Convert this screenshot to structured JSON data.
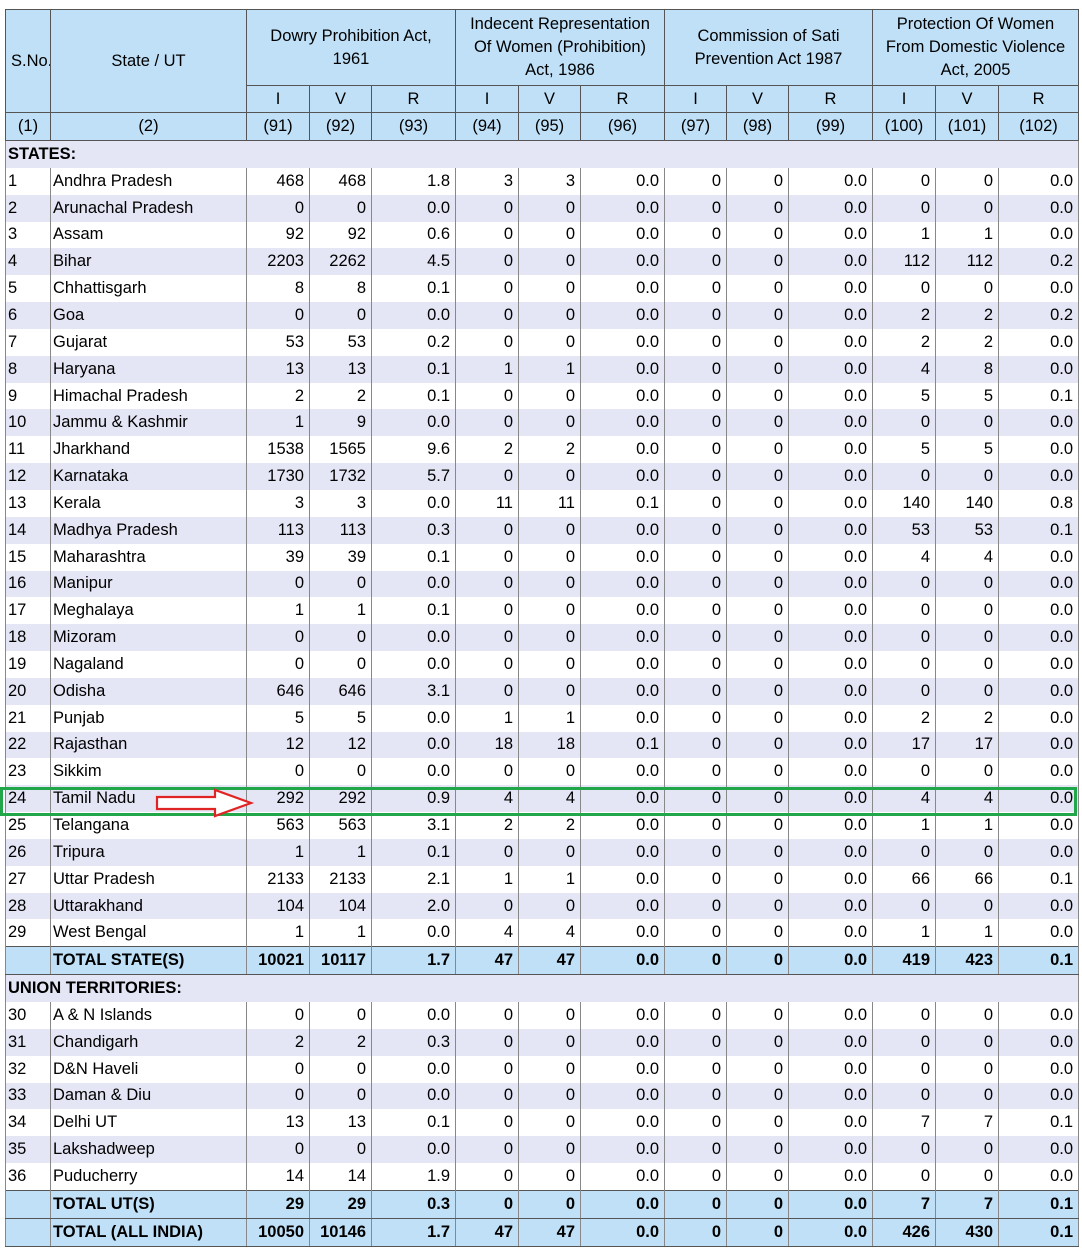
{
  "header": {
    "sno": "S.No.",
    "state": "State / UT",
    "groups": [
      "Dowry Prohibition Act, 1961",
      "Indecent Representation Of Women (Prohibition) Act, 1986",
      "Commission of Sati Prevention Act 1987",
      "Protection Of Women From Domestic Violence Act, 2005"
    ],
    "sub": [
      "I",
      "V",
      "R",
      "I",
      "V",
      "R",
      "I",
      "V",
      "R",
      "I",
      "V",
      "R"
    ],
    "colnums": [
      "(1)",
      "(2)",
      "(91)",
      "(92)",
      "(93)",
      "(94)",
      "(95)",
      "(96)",
      "(97)",
      "(98)",
      "(99)",
      "(100)",
      "(101)",
      "(102)"
    ]
  },
  "sections": [
    {
      "title": "STATES:",
      "rows": [
        [
          "1",
          "Andhra Pradesh",
          "468",
          "468",
          "1.8",
          "3",
          "3",
          "0.0",
          "0",
          "0",
          "0.0",
          "0",
          "0",
          "0.0"
        ],
        [
          "2",
          "Arunachal Pradesh",
          "0",
          "0",
          "0.0",
          "0",
          "0",
          "0.0",
          "0",
          "0",
          "0.0",
          "0",
          "0",
          "0.0"
        ],
        [
          "3",
          "Assam",
          "92",
          "92",
          "0.6",
          "0",
          "0",
          "0.0",
          "0",
          "0",
          "0.0",
          "1",
          "1",
          "0.0"
        ],
        [
          "4",
          "Bihar",
          "2203",
          "2262",
          "4.5",
          "0",
          "0",
          "0.0",
          "0",
          "0",
          "0.0",
          "112",
          "112",
          "0.2"
        ],
        [
          "5",
          "Chhattisgarh",
          "8",
          "8",
          "0.1",
          "0",
          "0",
          "0.0",
          "0",
          "0",
          "0.0",
          "0",
          "0",
          "0.0"
        ],
        [
          "6",
          "Goa",
          "0",
          "0",
          "0.0",
          "0",
          "0",
          "0.0",
          "0",
          "0",
          "0.0",
          "2",
          "2",
          "0.2"
        ],
        [
          "7",
          "Gujarat",
          "53",
          "53",
          "0.2",
          "0",
          "0",
          "0.0",
          "0",
          "0",
          "0.0",
          "2",
          "2",
          "0.0"
        ],
        [
          "8",
          "Haryana",
          "13",
          "13",
          "0.1",
          "1",
          "1",
          "0.0",
          "0",
          "0",
          "0.0",
          "4",
          "8",
          "0.0"
        ],
        [
          "9",
          "Himachal Pradesh",
          "2",
          "2",
          "0.1",
          "0",
          "0",
          "0.0",
          "0",
          "0",
          "0.0",
          "5",
          "5",
          "0.1"
        ],
        [
          "10",
          "Jammu & Kashmir",
          "1",
          "9",
          "0.0",
          "0",
          "0",
          "0.0",
          "0",
          "0",
          "0.0",
          "0",
          "0",
          "0.0"
        ],
        [
          "11",
          "Jharkhand",
          "1538",
          "1565",
          "9.6",
          "2",
          "2",
          "0.0",
          "0",
          "0",
          "0.0",
          "5",
          "5",
          "0.0"
        ],
        [
          "12",
          "Karnataka",
          "1730",
          "1732",
          "5.7",
          "0",
          "0",
          "0.0",
          "0",
          "0",
          "0.0",
          "0",
          "0",
          "0.0"
        ],
        [
          "13",
          "Kerala",
          "3",
          "3",
          "0.0",
          "11",
          "11",
          "0.1",
          "0",
          "0",
          "0.0",
          "140",
          "140",
          "0.8"
        ],
        [
          "14",
          "Madhya Pradesh",
          "113",
          "113",
          "0.3",
          "0",
          "0",
          "0.0",
          "0",
          "0",
          "0.0",
          "53",
          "53",
          "0.1"
        ],
        [
          "15",
          "Maharashtra",
          "39",
          "39",
          "0.1",
          "0",
          "0",
          "0.0",
          "0",
          "0",
          "0.0",
          "4",
          "4",
          "0.0"
        ],
        [
          "16",
          "Manipur",
          "0",
          "0",
          "0.0",
          "0",
          "0",
          "0.0",
          "0",
          "0",
          "0.0",
          "0",
          "0",
          "0.0"
        ],
        [
          "17",
          "Meghalaya",
          "1",
          "1",
          "0.1",
          "0",
          "0",
          "0.0",
          "0",
          "0",
          "0.0",
          "0",
          "0",
          "0.0"
        ],
        [
          "18",
          "Mizoram",
          "0",
          "0",
          "0.0",
          "0",
          "0",
          "0.0",
          "0",
          "0",
          "0.0",
          "0",
          "0",
          "0.0"
        ],
        [
          "19",
          "Nagaland",
          "0",
          "0",
          "0.0",
          "0",
          "0",
          "0.0",
          "0",
          "0",
          "0.0",
          "0",
          "0",
          "0.0"
        ],
        [
          "20",
          "Odisha",
          "646",
          "646",
          "3.1",
          "0",
          "0",
          "0.0",
          "0",
          "0",
          "0.0",
          "0",
          "0",
          "0.0"
        ],
        [
          "21",
          "Punjab",
          "5",
          "5",
          "0.0",
          "1",
          "1",
          "0.0",
          "0",
          "0",
          "0.0",
          "2",
          "2",
          "0.0"
        ],
        [
          "22",
          "Rajasthan",
          "12",
          "12",
          "0.0",
          "18",
          "18",
          "0.1",
          "0",
          "0",
          "0.0",
          "17",
          "17",
          "0.0"
        ],
        [
          "23",
          "Sikkim",
          "0",
          "0",
          "0.0",
          "0",
          "0",
          "0.0",
          "0",
          "0",
          "0.0",
          "0",
          "0",
          "0.0"
        ],
        [
          "24",
          "Tamil Nadu",
          "292",
          "292",
          "0.9",
          "4",
          "4",
          "0.0",
          "0",
          "0",
          "0.0",
          "4",
          "4",
          "0.0"
        ],
        [
          "25",
          "Telangana",
          "563",
          "563",
          "3.1",
          "2",
          "2",
          "0.0",
          "0",
          "0",
          "0.0",
          "1",
          "1",
          "0.0"
        ],
        [
          "26",
          "Tripura",
          "1",
          "1",
          "0.1",
          "0",
          "0",
          "0.0",
          "0",
          "0",
          "0.0",
          "0",
          "0",
          "0.0"
        ],
        [
          "27",
          "Uttar Pradesh",
          "2133",
          "2133",
          "2.1",
          "1",
          "1",
          "0.0",
          "0",
          "0",
          "0.0",
          "66",
          "66",
          "0.1"
        ],
        [
          "28",
          "Uttarakhand",
          "104",
          "104",
          "2.0",
          "0",
          "0",
          "0.0",
          "0",
          "0",
          "0.0",
          "0",
          "0",
          "0.0"
        ],
        [
          "29",
          "West Bengal",
          "1",
          "1",
          "0.0",
          "4",
          "4",
          "0.0",
          "0",
          "0",
          "0.0",
          "1",
          "1",
          "0.0"
        ]
      ],
      "total": [
        "",
        "TOTAL STATE(S)",
        "10021",
        "10117",
        "1.7",
        "47",
        "47",
        "0.0",
        "0",
        "0",
        "0.0",
        "419",
        "423",
        "0.1"
      ]
    },
    {
      "title": "UNION TERRITORIES:",
      "rows": [
        [
          "30",
          "A & N Islands",
          "0",
          "0",
          "0.0",
          "0",
          "0",
          "0.0",
          "0",
          "0",
          "0.0",
          "0",
          "0",
          "0.0"
        ],
        [
          "31",
          "Chandigarh",
          "2",
          "2",
          "0.3",
          "0",
          "0",
          "0.0",
          "0",
          "0",
          "0.0",
          "0",
          "0",
          "0.0"
        ],
        [
          "32",
          "D&N Haveli",
          "0",
          "0",
          "0.0",
          "0",
          "0",
          "0.0",
          "0",
          "0",
          "0.0",
          "0",
          "0",
          "0.0"
        ],
        [
          "33",
          "Daman & Diu",
          "0",
          "0",
          "0.0",
          "0",
          "0",
          "0.0",
          "0",
          "0",
          "0.0",
          "0",
          "0",
          "0.0"
        ],
        [
          "34",
          "Delhi UT",
          "13",
          "13",
          "0.1",
          "0",
          "0",
          "0.0",
          "0",
          "0",
          "0.0",
          "7",
          "7",
          "0.1"
        ],
        [
          "35",
          "Lakshadweep",
          "0",
          "0",
          "0.0",
          "0",
          "0",
          "0.0",
          "0",
          "0",
          "0.0",
          "0",
          "0",
          "0.0"
        ],
        [
          "36",
          "Puducherry",
          "14",
          "14",
          "1.9",
          "0",
          "0",
          "0.0",
          "0",
          "0",
          "0.0",
          "0",
          "0",
          "0.0"
        ]
      ],
      "total": [
        "",
        "TOTAL UT(S)",
        "29",
        "29",
        "0.3",
        "0",
        "0",
        "0.0",
        "0",
        "0",
        "0.0",
        "7",
        "7",
        "0.1"
      ]
    }
  ],
  "grand_total": [
    "",
    "TOTAL (ALL INDIA)",
    "10050",
    "10146",
    "1.7",
    "47",
    "47",
    "0.0",
    "0",
    "0",
    "0.0",
    "426",
    "430",
    "0.1"
  ],
  "highlight": {
    "row_label": "Tamil Nadu",
    "box_color": "#22a64a",
    "arrow_color": "#e02424"
  }
}
